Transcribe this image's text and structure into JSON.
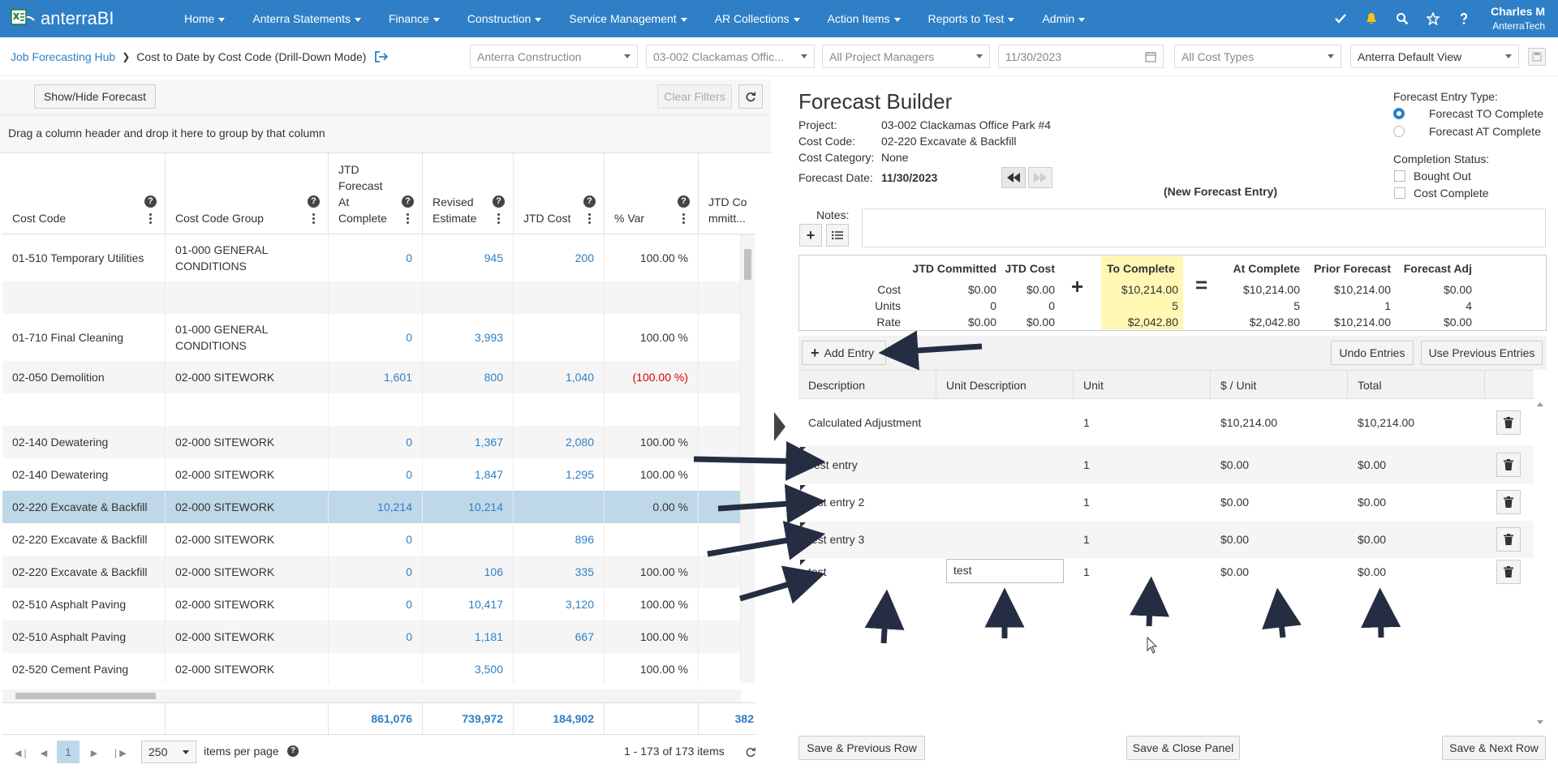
{
  "app": {
    "logo_text": "anterraBI",
    "nav": [
      "Home",
      "Anterra Statements",
      "Finance",
      "Construction",
      "Service Management",
      "AR Collections",
      "Action Items",
      "Reports to Test",
      "Admin"
    ],
    "user_name": "Charles M",
    "user_company": "AnterraTech",
    "icons": [
      "check-icon",
      "bell-icon",
      "search-icon",
      "star-icon",
      "help-icon"
    ]
  },
  "breadcrumb": {
    "parent": "Job Forecasting Hub",
    "current": "Cost to Date by Cost Code  (Drill-Down Mode)"
  },
  "filters": {
    "company": "Anterra Construction",
    "project": "03-002 Clackamas Offic...",
    "managers": "All Project Managers",
    "date": "11/30/2023",
    "cost_types": "All Cost Types",
    "view": "Anterra Default View"
  },
  "grid": {
    "show_hide_label": "Show/Hide Forecast",
    "clear_filters_label": "Clear Filters",
    "group_hint": "Drag a column header and drop it here to group by that column",
    "columns": [
      "Cost Code",
      "Cost Code Group",
      "JTD Forecast At Complete",
      "Revised Estimate",
      "JTD Cost",
      "% Var",
      "JTD Committ..."
    ],
    "rows": [
      {
        "code": "01-510 Temporary Utilities",
        "group": "01-000 GENERAL CONDITIONS",
        "forecast": "0",
        "revised": "945",
        "jtd": "200",
        "pct": "100.00 %"
      },
      {
        "code": "",
        "group": "",
        "forecast": "",
        "revised": "",
        "jtd": "",
        "pct": ""
      },
      {
        "code": "01-710 Final Cleaning",
        "group": "01-000 GENERAL CONDITIONS",
        "forecast": "0",
        "revised": "3,993",
        "jtd": "",
        "pct": "100.00 %"
      },
      {
        "code": "02-050 Demolition",
        "group": "02-000 SITEWORK",
        "forecast": "1,601",
        "revised": "800",
        "jtd": "1,040",
        "pct": "(100.00 %)"
      },
      {
        "code": "",
        "group": "",
        "forecast": "",
        "revised": "",
        "jtd": "",
        "pct": ""
      },
      {
        "code": "02-140 Dewatering",
        "group": "02-000 SITEWORK",
        "forecast": "0",
        "revised": "1,367",
        "jtd": "2,080",
        "pct": "100.00 %"
      },
      {
        "code": "02-140 Dewatering",
        "group": "02-000 SITEWORK",
        "forecast": "0",
        "revised": "1,847",
        "jtd": "1,295",
        "pct": "100.00 %"
      },
      {
        "code": "02-220 Excavate & Backfill",
        "group": "02-000 SITEWORK",
        "forecast": "10,214",
        "revised": "10,214",
        "jtd": "",
        "pct": "0.00 %"
      },
      {
        "code": "02-220 Excavate & Backfill",
        "group": "02-000 SITEWORK",
        "forecast": "0",
        "revised": "",
        "jtd": "896",
        "pct": ""
      },
      {
        "code": "02-220 Excavate & Backfill",
        "group": "02-000 SITEWORK",
        "forecast": "0",
        "revised": "106",
        "jtd": "335",
        "pct": "100.00 %"
      },
      {
        "code": "02-510 Asphalt Paving",
        "group": "02-000 SITEWORK",
        "forecast": "0",
        "revised": "10,417",
        "jtd": "3,120",
        "pct": "100.00 %"
      },
      {
        "code": "02-510 Asphalt Paving",
        "group": "02-000 SITEWORK",
        "forecast": "0",
        "revised": "1,181",
        "jtd": "667",
        "pct": "100.00 %"
      },
      {
        "code": "02-520 Cement Paving",
        "group": "02-000 SITEWORK",
        "forecast": "",
        "revised": "3,500",
        "jtd": "",
        "pct": "100.00 %"
      }
    ],
    "totals": {
      "forecast": "861,076",
      "revised": "739,972",
      "jtd": "184,902",
      "committed": "382"
    },
    "pager": {
      "page": "1",
      "page_size": "250",
      "per_page_label": "items per page",
      "range": "1 - 173 of 173 items"
    }
  },
  "forecast": {
    "title": "Forecast Builder",
    "project_label": "Project:",
    "project": "03-002 Clackamas Office Park #4",
    "costcode_label": "Cost Code:",
    "costcode": "02-220 Excavate & Backfill",
    "category_label": "Cost Category:",
    "category": "None",
    "date_label": "Forecast Date:",
    "date": "11/30/2023",
    "new_entry": "(New Forecast Entry)",
    "entry_type_label": "Forecast Entry Type:",
    "entry_type_options": [
      "Forecast TO Complete",
      "Forecast AT Complete"
    ],
    "completion_label": "Completion Status:",
    "completion_options": [
      "Bought Out",
      "Cost Complete"
    ],
    "notes_label": "Notes:",
    "summary": {
      "headers": [
        "JTD Committed",
        "JTD Cost",
        "To Complete",
        "At Complete",
        "Prior Forecast",
        "Forecast Adj"
      ],
      "row_labels": [
        "Cost",
        "Units",
        "Rate"
      ],
      "jtd_committed": [
        "$0.00",
        "0",
        "$0.00"
      ],
      "jtd_cost": [
        "$0.00",
        "0",
        "$0.00"
      ],
      "to_complete": [
        "$10,214.00",
        "5",
        "$2,042.80"
      ],
      "at_complete": [
        "$10,214.00",
        "5",
        "$2,042.80"
      ],
      "prior_forecast": [
        "$10,214.00",
        "1",
        "$10,214.00"
      ],
      "forecast_adj": [
        "$0.00",
        "4",
        "$0.00"
      ],
      "plus": "+",
      "equals": "="
    },
    "add_entry_label": "Add Entry",
    "undo_label": "Undo Entries",
    "use_prev_label": "Use Previous Entries",
    "entry_columns": [
      "Description",
      "Unit Description",
      "Unit",
      "$ / Unit",
      "Total"
    ],
    "entries": [
      {
        "desc": "Calculated Adjustment",
        "unit_desc": "",
        "unit": "1",
        "per_unit": "$10,214.00",
        "total": "$10,214.00"
      },
      {
        "desc": "Test entry",
        "unit_desc": "",
        "unit": "1",
        "per_unit": "$0.00",
        "total": "$0.00"
      },
      {
        "desc": "test entry 2",
        "unit_desc": "",
        "unit": "1",
        "per_unit": "$0.00",
        "total": "$0.00"
      },
      {
        "desc": "test entry 3",
        "unit_desc": "",
        "unit": "1",
        "per_unit": "$0.00",
        "total": "$0.00"
      },
      {
        "desc": "test",
        "unit_desc": "test",
        "unit": "1",
        "per_unit": "$0.00",
        "total": "$0.00"
      }
    ],
    "save_prev_label": "Save & Previous Row",
    "save_close_label": "Save & Close Panel",
    "save_next_label": "Save & Next Row"
  }
}
